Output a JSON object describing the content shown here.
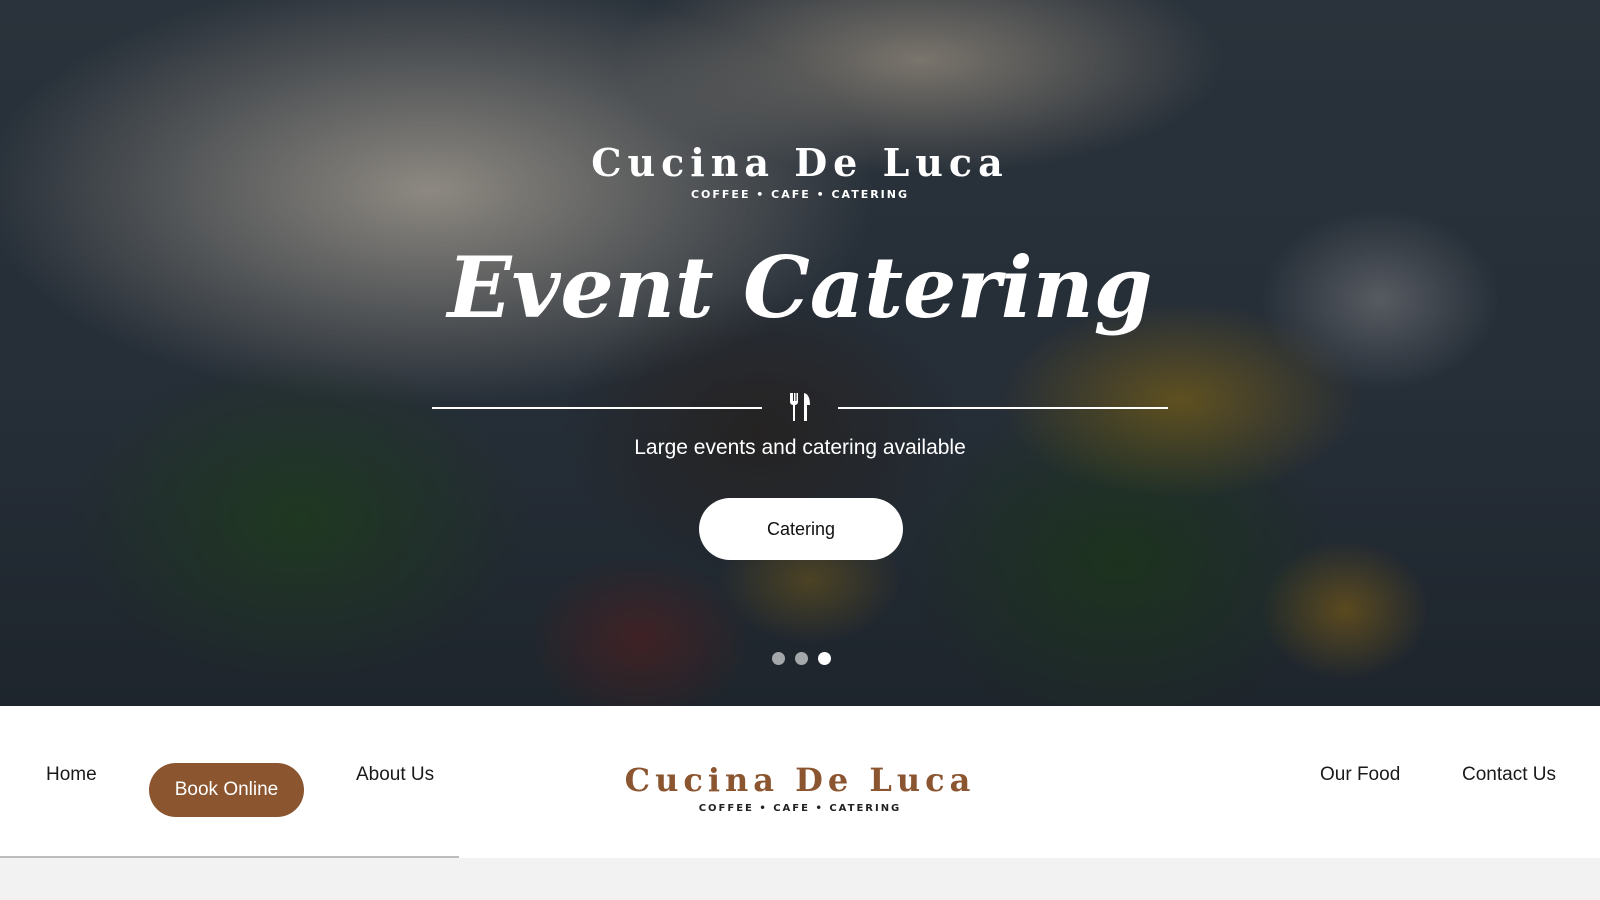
{
  "hero": {
    "logo_main": "Cucina De Luca",
    "logo_sub": "COFFEE • CAFE • CATERING",
    "title": "Event Catering",
    "subtitle": "Large events and catering available",
    "cta_label": "Catering",
    "divider_icon": "utensils-icon",
    "slides": {
      "count": 3,
      "active_index": 2
    }
  },
  "nav": {
    "home": "Home",
    "book_online": "Book Online",
    "about": "About Us",
    "logo_main": "Cucina De Luca",
    "logo_sub": "COFFEE • CAFE • CATERING",
    "our_food": "Our Food",
    "contact": "Contact Us"
  },
  "colors": {
    "brand_brown": "#8b5530",
    "white": "#ffffff",
    "text_dark": "#1a1a1a"
  }
}
